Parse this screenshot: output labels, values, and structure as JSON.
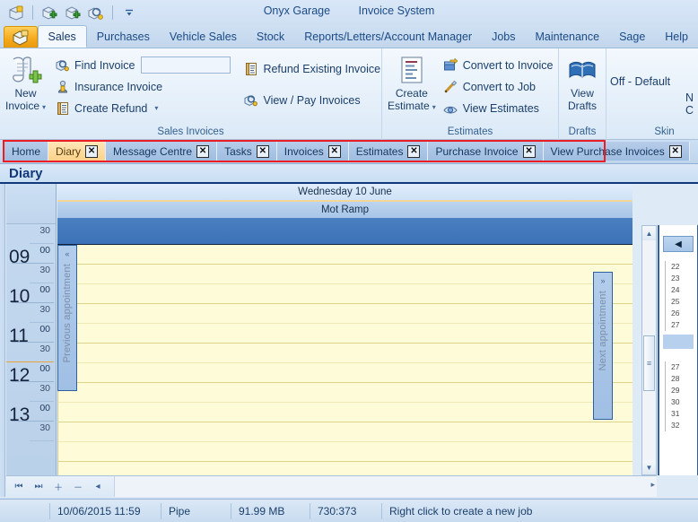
{
  "window": {
    "title_left": "Onyx Garage",
    "title_right": "Invoice System",
    "quick_access": [
      {
        "name": "open-invoice-icon",
        "glyph": "🗂"
      },
      {
        "name": "new-invoice-icon",
        "glyph": "🗂"
      },
      {
        "name": "new-job-icon",
        "glyph": "🗂"
      },
      {
        "name": "find-invoice-icon",
        "glyph": "🔍"
      },
      {
        "name": "customize-quick-access-icon",
        "glyph": "▾"
      }
    ]
  },
  "ribbon": {
    "office_button_label": "",
    "tabs": [
      {
        "label": "Sales",
        "active": true
      },
      {
        "label": "Purchases",
        "active": false
      },
      {
        "label": "Vehicle Sales",
        "active": false
      },
      {
        "label": "Stock",
        "active": false
      },
      {
        "label": "Reports/Letters/Account Manager",
        "active": false
      },
      {
        "label": "Jobs",
        "active": false
      },
      {
        "label": "Maintenance",
        "active": false
      },
      {
        "label": "Sage",
        "active": false
      },
      {
        "label": "Help",
        "active": false
      }
    ],
    "groups": {
      "sales_invoices": {
        "title": "Sales Invoices",
        "new_invoice_label": "New\nInvoice",
        "new_invoice_line1": "New",
        "new_invoice_line2": "Invoice",
        "find_invoice_label": "Find Invoice",
        "find_invoice_value": "",
        "find_invoice_placeholder": "",
        "insurance_invoice_label": "Insurance Invoice",
        "create_refund_label": "Create Refund",
        "refund_existing_label": "Refund Existing Invoice",
        "view_pay_label": "View / Pay Invoices"
      },
      "estimates": {
        "title": "Estimates",
        "create_estimate_line1": "Create",
        "create_estimate_line2": "Estimate",
        "convert_to_invoice_label": "Convert to Invoice",
        "convert_to_job_label": "Convert to Job",
        "view_estimates_label": "View Estimates"
      },
      "drafts": {
        "title": "Drafts",
        "view_drafts_line1": "View",
        "view_drafts_line2": "Drafts"
      },
      "skin": {
        "title": "Skin",
        "current_skin": "Off - Default",
        "clipped_line1": "N",
        "clipped_line2": "C"
      }
    }
  },
  "document_tabs": [
    {
      "label": "Home",
      "selected": false,
      "closable": false
    },
    {
      "label": "Diary",
      "selected": true,
      "closable": true
    },
    {
      "label": "Message Centre",
      "selected": false,
      "closable": true
    },
    {
      "label": "Tasks",
      "selected": false,
      "closable": true
    },
    {
      "label": "Invoices",
      "selected": false,
      "closable": true
    },
    {
      "label": "Estimates",
      "selected": false,
      "closable": true
    },
    {
      "label": "Purchase Invoice",
      "selected": false,
      "closable": true
    },
    {
      "label": "View Purchase Invoices",
      "selected": false,
      "closable": true
    }
  ],
  "close_glyph": "✕",
  "diary": {
    "heading": "Diary",
    "date_header": "Wednesday 10 June",
    "resource_header": "Mot Ramp",
    "prev_appointment_label": "Previous appointment",
    "next_appointment_label": "Next appointment",
    "prev_arrow": "«",
    "next_arrow": "»",
    "time_slots": [
      {
        "hour": "",
        "minute": "30",
        "half": true,
        "now": false
      },
      {
        "hour": "09",
        "minute": "00",
        "half": false,
        "now": false
      },
      {
        "hour": "",
        "minute": "30",
        "half": true,
        "now": false
      },
      {
        "hour": "10",
        "minute": "00",
        "half": false,
        "now": false
      },
      {
        "hour": "",
        "minute": "30",
        "half": true,
        "now": false
      },
      {
        "hour": "11",
        "minute": "00",
        "half": false,
        "now": false
      },
      {
        "hour": "",
        "minute": "30",
        "half": true,
        "now": true
      },
      {
        "hour": "12",
        "minute": "00",
        "half": false,
        "now": false
      },
      {
        "hour": "",
        "minute": "30",
        "half": true,
        "now": false
      },
      {
        "hour": "13",
        "minute": "00",
        "half": false,
        "now": false
      },
      {
        "hour": "",
        "minute": "30",
        "half": true,
        "now": false
      }
    ],
    "nav_buttons": [
      {
        "name": "first-day-button",
        "glyph": "⏮"
      },
      {
        "name": "last-day-button",
        "glyph": "⏭"
      },
      {
        "name": "add-day-button",
        "glyph": "＋"
      },
      {
        "name": "remove-day-button",
        "glyph": "－"
      },
      {
        "name": "scroll-left-button",
        "glyph": "◂"
      }
    ],
    "scroll_up_glyph": "▲",
    "scroll_down_glyph": "▼",
    "scroll_grip": "≡",
    "hscroll_right_glyph": "▸",
    "week_panel": {
      "nav_glyph": "◀",
      "group_one": [
        "22",
        "23",
        "24",
        "25",
        "26",
        "27"
      ],
      "group_two": [
        "27",
        "28",
        "29",
        "30",
        "31",
        "32"
      ]
    }
  },
  "statusbar": {
    "datetime": "10/06/2015 11:59",
    "user": "Pipe",
    "memory": "91.99 MB",
    "counter": "730:373",
    "hint": "Right click to create a new job"
  },
  "colors": {
    "accent_blue": "#1b4b86",
    "highlight_red": "#ec1c24",
    "selected_tab_orange": "#fcd28a",
    "appointment_bg": "#fdfbd8",
    "band_blue": "#3c72b7"
  }
}
